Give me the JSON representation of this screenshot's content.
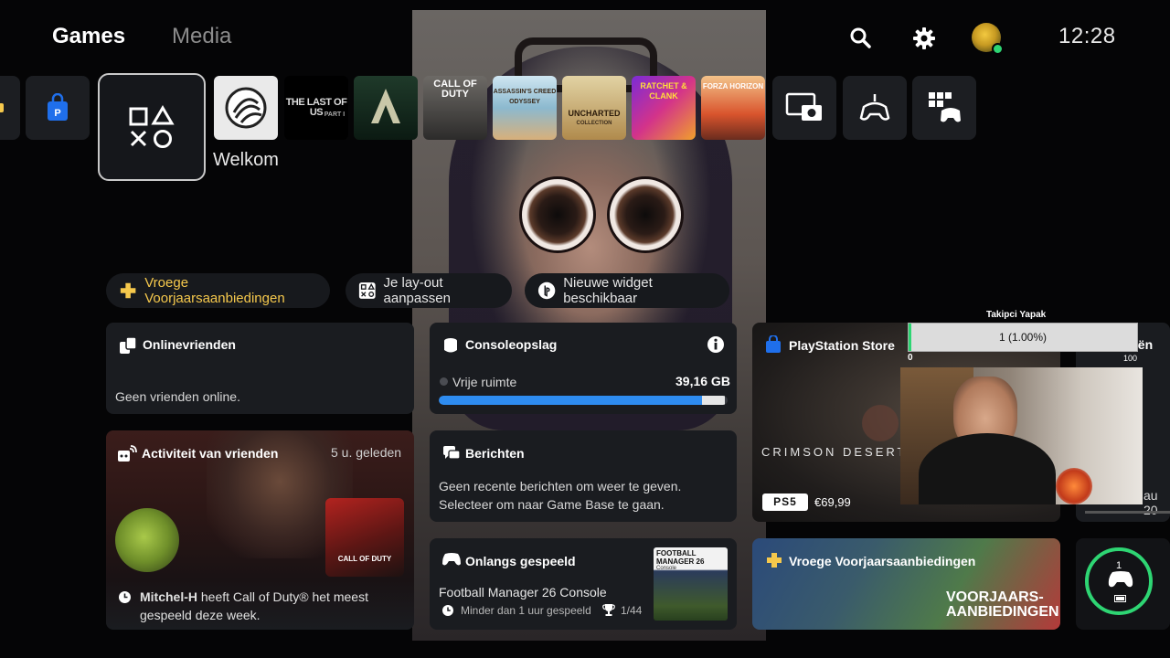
{
  "nav": {
    "tab_games": "Games",
    "tab_media": "Media",
    "clock": "12:28"
  },
  "tiles": {
    "welcome_label": "Welkom",
    "last_of_us_title": "THE LAST OF US",
    "last_of_us_sub": "PART I",
    "call_of_duty": "CALL OF DUTY",
    "assassins": "ASSASSIN'S CREED ODYSSEY",
    "uncharted": "UNCHARTED",
    "uncharted_sub": "COLLECTION",
    "ratchet": "RATCHET & CLANK",
    "forza": "FORZA HORIZON"
  },
  "chips": {
    "offers": "Vroege Voorjaarsaanbiedingen",
    "layout": "Je lay-out aanpassen",
    "widget": "Nieuwe widget beschikbaar"
  },
  "friends": {
    "title": "Onlinevrienden",
    "empty": "Geen vrienden online."
  },
  "activity": {
    "title": "Activiteit van vrienden",
    "time": "5 u. geleden",
    "user": "Mitchel-H",
    "text": " heeft Call of Duty® het meest gespeeld deze week.",
    "cover_text": "CALL OF DUTY"
  },
  "storage": {
    "title": "Consoleopslag",
    "free_label": "Vrije ruimte",
    "free_value": "39,16 GB",
    "used_fraction": 0.91
  },
  "messages": {
    "title": "Berichten",
    "line1": "Geen recente berichten om weer te geven.",
    "line2": "Selecteer om naar Game Base te gaan."
  },
  "recent": {
    "title": "Onlangs gespeeld",
    "game": "Football Manager 26 Console",
    "played": "Minder dan 1 uur gespeeld",
    "trophies": "1/44",
    "cover_title": "FOOTBALL MANAGER 26",
    "cover_sub": "Console"
  },
  "store": {
    "title": "PlayStation Store",
    "game": "CRIMSON DESERT",
    "platform": "PS5",
    "price": "€69,99"
  },
  "offers_card": {
    "title": "Vroege Voorjaarsaanbiedingen",
    "badge_line1": "VOORJAARS-",
    "badge_line2": "AANBIEDINGEN"
  },
  "right_edge": {
    "partial_title": "eën",
    "partial_date": "au 20"
  },
  "controller": {
    "number": "1"
  },
  "stream_overlay": {
    "title": "Takipci Yapak",
    "value_text": "1 (1.00%)",
    "min": "0",
    "max": "100",
    "progress": 0.01
  },
  "colors": {
    "accent_gold": "#f5c84c",
    "ps_blue": "#1f6feb",
    "storage_bar": "#2e8cf0",
    "controller_ring": "#2ed573"
  }
}
